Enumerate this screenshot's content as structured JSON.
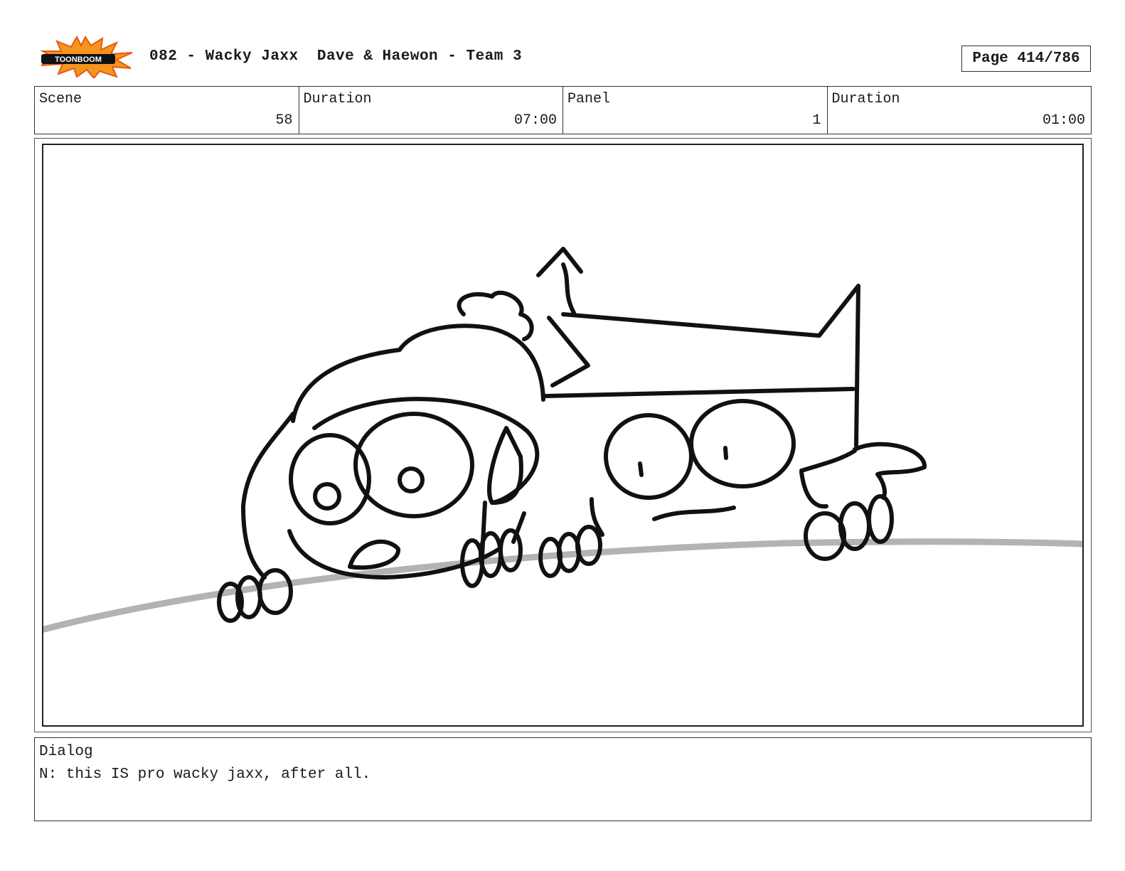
{
  "header": {
    "logo_text": "TOONBOOM",
    "title": "082 - Wacky Jaxx  Dave & Haewon - Team 3",
    "page": "Page 414/786"
  },
  "info": {
    "scene_label": "Scene",
    "scene_value": "58",
    "scene_duration_label": "Duration",
    "scene_duration_value": "07:00",
    "panel_label": "Panel",
    "panel_value": "1",
    "panel_duration_label": "Duration",
    "panel_duration_value": "01:00"
  },
  "dialog": {
    "label": "Dialog",
    "text": "N: this IS pro wacky jaxx, after all."
  },
  "colors": {
    "logo_burst": "#f7941d",
    "logo_burst_dark": "#e35b12",
    "ground_line": "#b3b3b3",
    "ink": "#111111"
  }
}
